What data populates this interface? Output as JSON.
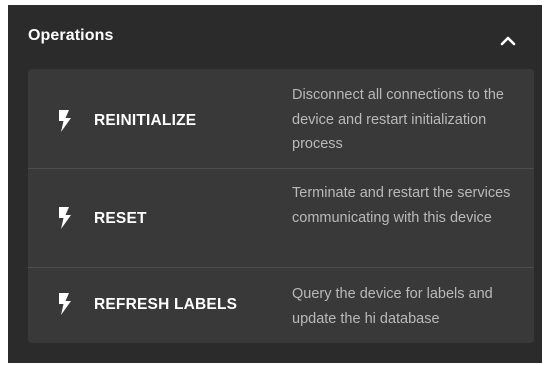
{
  "panel": {
    "title": "Operations",
    "collapse_icon": "chevron-up-icon"
  },
  "operations": [
    {
      "icon": "lightning-bolt-icon",
      "label": "REINITIALIZE",
      "description": "Disconnect all connections to the device and restart initialization process"
    },
    {
      "icon": "lightning-bolt-icon",
      "label": "RESET",
      "description": "Terminate and restart the services communicating with this device"
    },
    {
      "icon": "lightning-bolt-icon",
      "label": "REFRESH LABELS",
      "description": "Query the device for labels and update the hi database"
    }
  ],
  "colors": {
    "panel_background": "#2b2b2b",
    "card_background": "#393939",
    "divider": "#4d4d4d",
    "label_text": "#ffffff",
    "description_text": "#b9b9b9"
  }
}
